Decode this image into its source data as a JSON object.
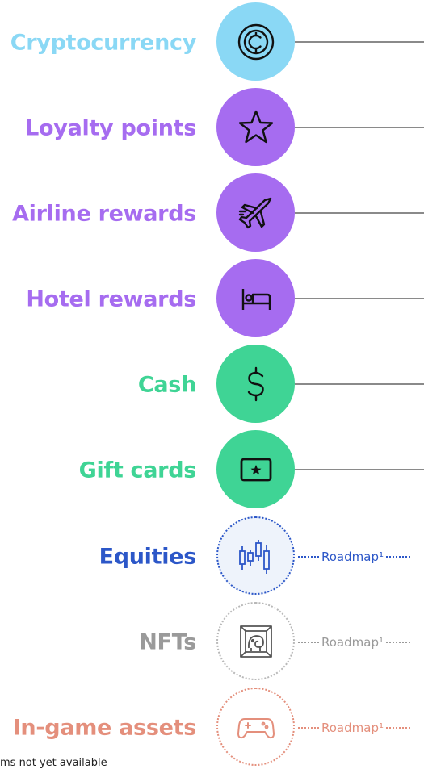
{
  "items": [
    {
      "label": "Cryptocurrency",
      "color": "#8ad8f5",
      "icon": "crypto-coin-icon"
    },
    {
      "label": "Loyalty points",
      "color": "#a66cf0",
      "icon": "star-icon"
    },
    {
      "label": "Airline rewards",
      "color": "#a66cf0",
      "icon": "airplane-icon"
    },
    {
      "label": "Hotel rewards",
      "color": "#a66cf0",
      "icon": "hotel-bed-icon"
    },
    {
      "label": "Cash",
      "color": "#3fd495",
      "icon": "dollar-icon"
    },
    {
      "label": "Gift cards",
      "color": "#3fd495",
      "icon": "gift-card-icon"
    },
    {
      "label": "Equities",
      "color": "#2c57c8",
      "icon": "candlestick-chart-icon",
      "roadmap": "Roadmap¹"
    },
    {
      "label": "NFTs",
      "color": "#9a9a9a",
      "icon": "nft-frame-icon",
      "roadmap": "Roadmap¹"
    },
    {
      "label": "In-game assets",
      "color": "#e48f7c",
      "icon": "game-controller-icon",
      "roadmap": "Roadmap¹"
    }
  ],
  "footnote": "ms not yet available"
}
